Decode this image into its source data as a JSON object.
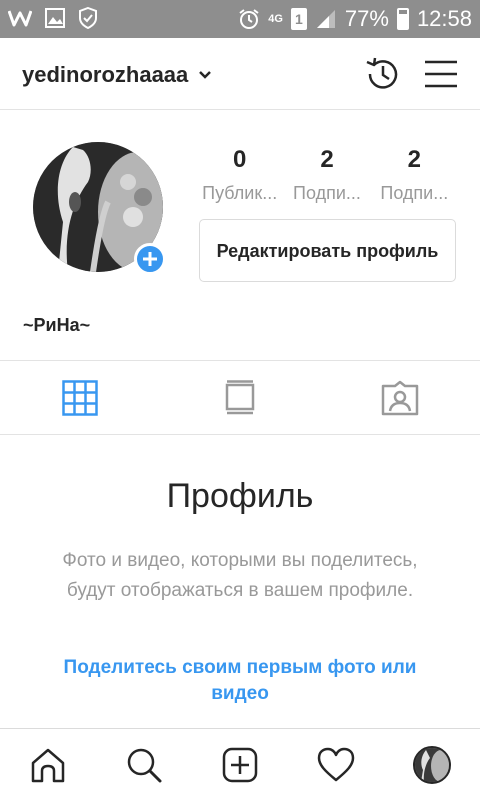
{
  "status_bar": {
    "network": "4G",
    "sim": "1",
    "battery": "77%",
    "battery_level": 0.77,
    "time": "12:58"
  },
  "header": {
    "username": "yedinorozhaaaa",
    "icons": [
      "chevron-down-icon",
      "history-icon",
      "menu-icon"
    ]
  },
  "profile": {
    "stats": [
      {
        "value": "0",
        "label": "Публик..."
      },
      {
        "value": "2",
        "label": "Подпи..."
      },
      {
        "value": "2",
        "label": "Подпи..."
      }
    ],
    "edit_button": "Редактировать профиль",
    "display_name": "~РиНа~"
  },
  "tabs": {
    "icons": [
      "grid-icon",
      "feed-icon",
      "tagged-icon"
    ],
    "active_color": "#3897f0"
  },
  "empty_state": {
    "title": "Профиль",
    "description": "Фото и видео, которыми вы поделитесь, будут отображаться в вашем профиле.",
    "link": "Поделитесь своим первым фото или видео"
  },
  "bottom_nav": {
    "icons": [
      "home-icon",
      "search-icon",
      "add-post-icon",
      "heart-icon",
      "profile-avatar-icon"
    ]
  },
  "colors": {
    "status_bar": "#8e8e8e",
    "accent": "#3897f0",
    "text": "#262626",
    "muted": "#999999"
  }
}
